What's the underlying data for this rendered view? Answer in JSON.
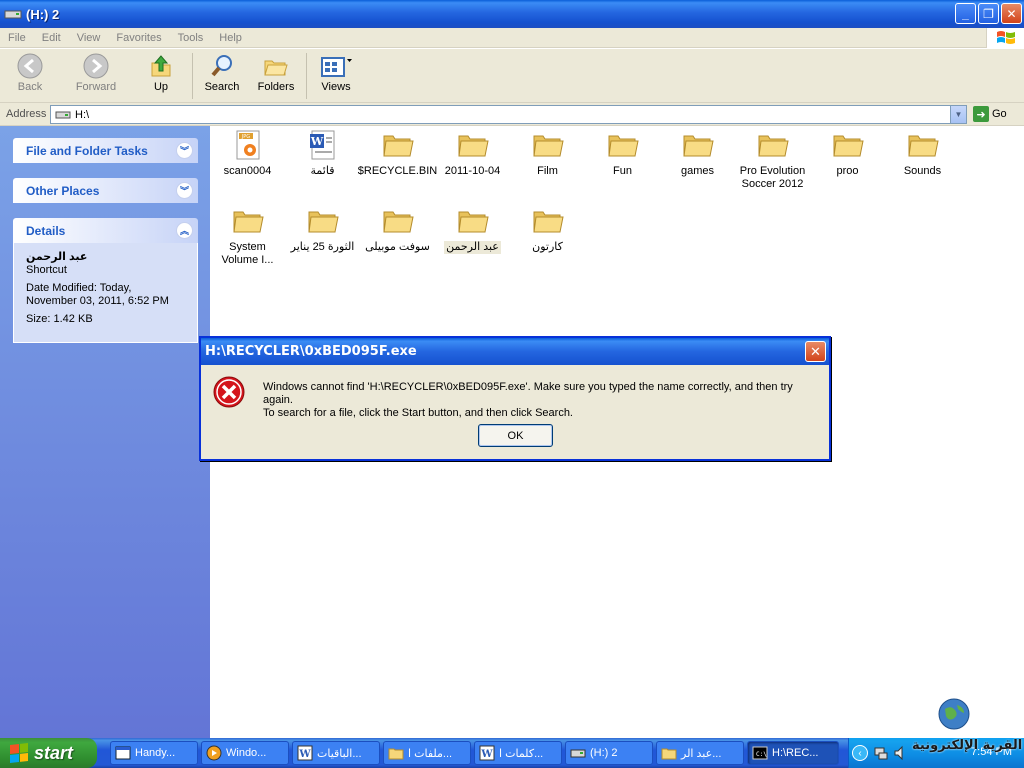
{
  "window": {
    "title": "(H:) 2"
  },
  "menu": [
    "File",
    "Edit",
    "View",
    "Favorites",
    "Tools",
    "Help"
  ],
  "toolbar": {
    "back": "Back",
    "forward": "Forward",
    "up": "Up",
    "search": "Search",
    "folders": "Folders",
    "views": "Views"
  },
  "address": {
    "label": "Address",
    "value": "H:\\",
    "go": "Go"
  },
  "left_pane": {
    "tasks_title": "File and Folder Tasks",
    "places_title": "Other Places",
    "details_title": "Details",
    "details": {
      "name": "عبد الرحمن",
      "type": "Shortcut",
      "modified": "Date Modified: Today, November 03, 2011, 6:52 PM",
      "size": "Size: 1.42 KB"
    }
  },
  "files": [
    {
      "name": "scan0004",
      "icon": "jpeg-file-icon"
    },
    {
      "name": "قائمة",
      "icon": "word-document-icon"
    },
    {
      "name": "$RECYCLE.BIN",
      "icon": "folder-icon"
    },
    {
      "name": "2011-10-04",
      "icon": "folder-icon"
    },
    {
      "name": "Film",
      "icon": "folder-icon"
    },
    {
      "name": "Fun",
      "icon": "folder-icon"
    },
    {
      "name": "games",
      "icon": "folder-icon"
    },
    {
      "name": "Pro Evolution Soccer 2012",
      "icon": "folder-icon"
    },
    {
      "name": "proo",
      "icon": "folder-icon"
    },
    {
      "name": "Sounds",
      "icon": "folder-icon"
    },
    {
      "name": "System Volume I...",
      "icon": "folder-icon"
    },
    {
      "name": "الثورة 25 يناير",
      "icon": "folder-icon"
    },
    {
      "name": "سوفت موبيلى",
      "icon": "folder-icon"
    },
    {
      "name": "عبد الرحمن",
      "icon": "folder-icon",
      "selected": true
    },
    {
      "name": "كارتون",
      "icon": "folder-icon"
    }
  ],
  "dialog": {
    "title": "H:\\RECYCLER\\0xBED095F.exe",
    "message_line1": "Windows cannot find 'H:\\RECYCLER\\0xBED095F.exe'. Make sure you typed the name correctly, and then try again.",
    "message_line2": "To search for a file, click the Start button, and then click Search.",
    "ok": "OK"
  },
  "taskbar": {
    "start": "start",
    "tasks": [
      {
        "label": "Handy...",
        "icon": "window-icon"
      },
      {
        "label": "Windo...",
        "icon": "media-player-icon"
      },
      {
        "label": "الباقيات...",
        "icon": "word-icon"
      },
      {
        "label": "ملفات ا...",
        "icon": "folder-icon"
      },
      {
        "label": "كلمات ا...",
        "icon": "word-icon"
      },
      {
        "label": "(H:) 2",
        "icon": "drive-icon"
      },
      {
        "label": "عبد الر...",
        "icon": "folder-icon"
      },
      {
        "label": "H:\\REC...",
        "icon": "cmd-icon",
        "active": true
      }
    ],
    "clock": "7:54 PM"
  },
  "watermark": "القرية الإلكترونية",
  "colors": {
    "title_blue": "#2466e0",
    "pane_blue": "#6375d6",
    "start_green": "#3fa83f",
    "tray_blue": "#0d8be3"
  }
}
